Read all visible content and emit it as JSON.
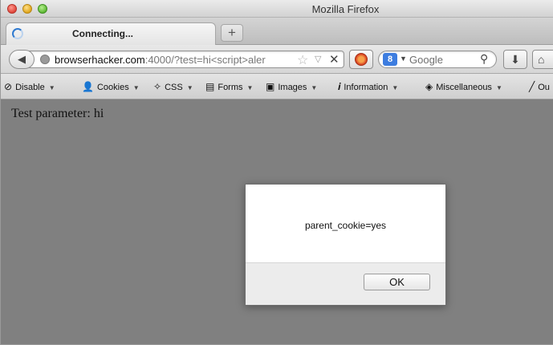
{
  "window": {
    "title": "Mozilla Firefox"
  },
  "tab": {
    "title": "Connecting..."
  },
  "newtab": {
    "symbol": "+"
  },
  "nav": {
    "back_symbol": "◀",
    "url_host": "browserhacker.com",
    "url_rest": ":4000/?test=hi<script>aler",
    "star_symbol": "☆",
    "drop_symbol": "▽",
    "stop_symbol": "✕"
  },
  "search": {
    "engine_letter": "8",
    "placeholder": "Google",
    "mag_symbol": "⚲"
  },
  "toolbar_buttons": {
    "download": "⬇",
    "home": "⌂"
  },
  "devbar": {
    "items": [
      {
        "icon": "⊘",
        "label": "Disable"
      },
      {
        "icon": "👤",
        "label": "Cookies"
      },
      {
        "icon": "✧",
        "label": "CSS"
      },
      {
        "icon": "▤",
        "label": "Forms"
      },
      {
        "icon": "▣",
        "label": "Images"
      },
      {
        "icon": "𝒊",
        "label": "Information"
      },
      {
        "icon": "◈",
        "label": "Miscellaneous"
      },
      {
        "icon": "╱",
        "label": "Ou"
      }
    ],
    "arrow": "▼"
  },
  "page": {
    "text": "Test parameter: hi"
  },
  "dialog": {
    "message": "parent_cookie=yes",
    "ok_label": "OK"
  }
}
